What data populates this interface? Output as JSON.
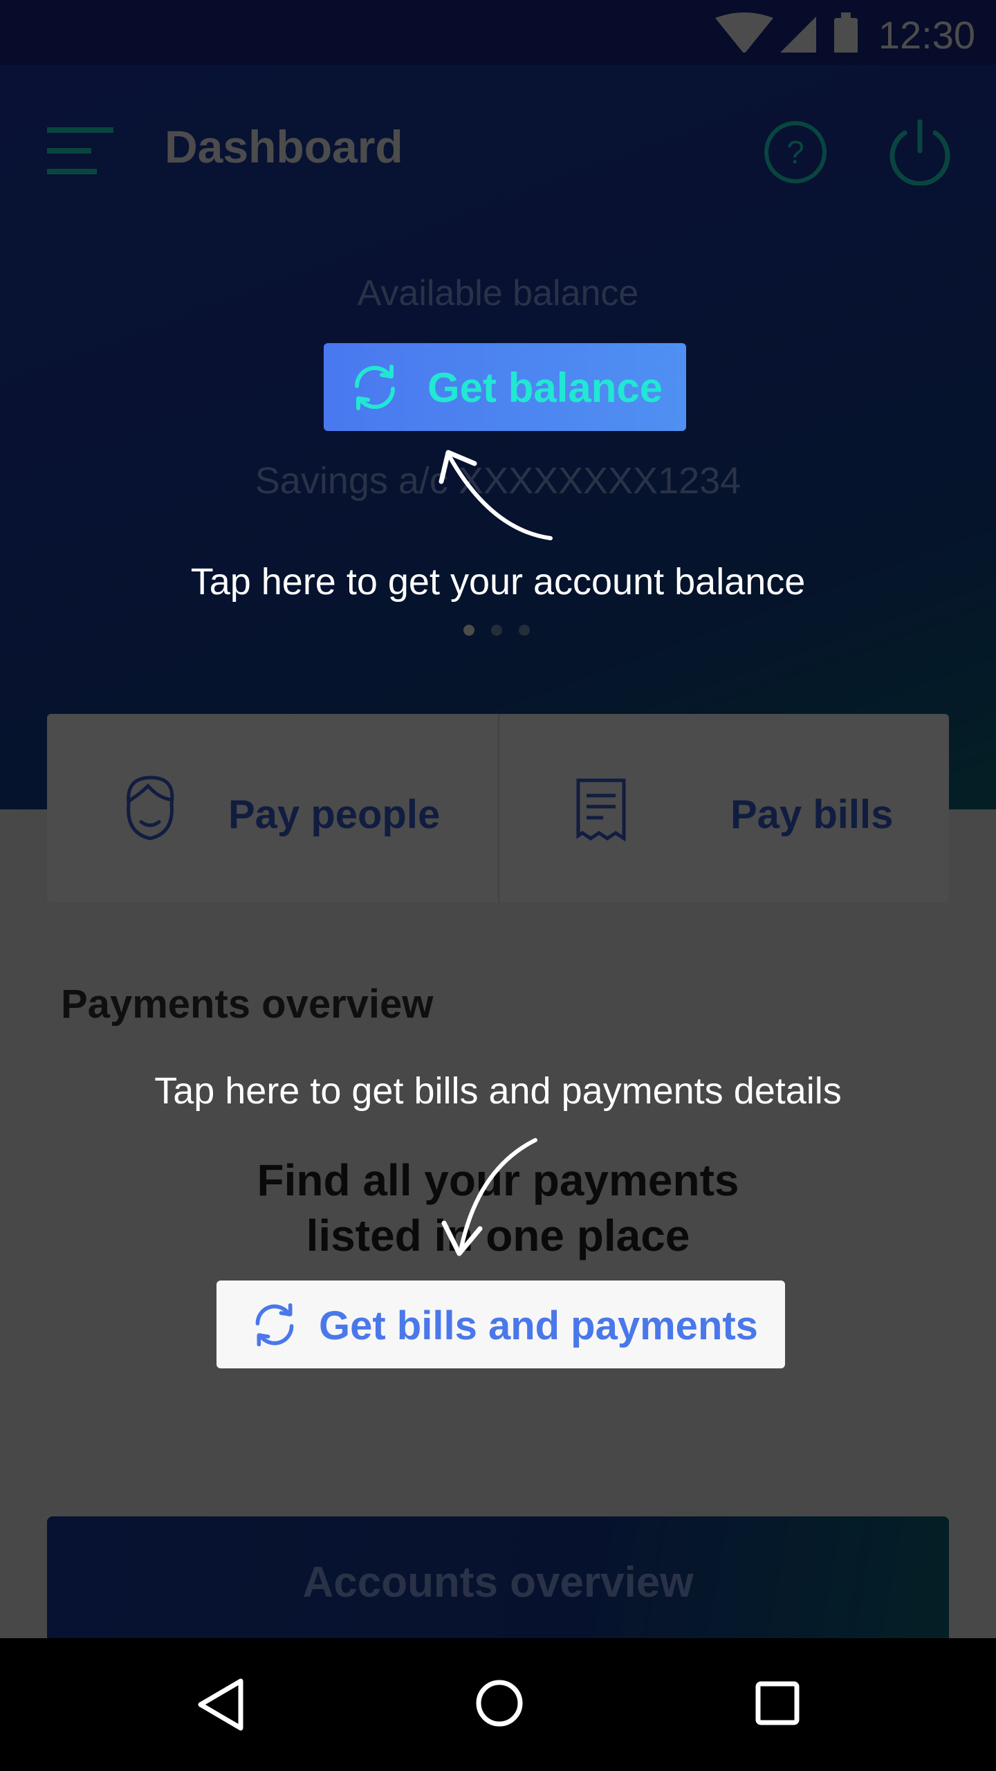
{
  "status_bar": {
    "time": "12:30",
    "icons": [
      "wifi-icon",
      "signal-icon",
      "battery-icon"
    ]
  },
  "app_bar": {
    "title": "Dashboard",
    "menu_icon": "menu-icon",
    "help_icon": "help-icon",
    "power_icon": "power-icon"
  },
  "balance": {
    "label": "Available balance",
    "button_label": "Get balance",
    "button_icon": "refresh-icon",
    "account": "Savings a/c XXXXXXXX1234",
    "pager_dots": 3,
    "pager_active": 0
  },
  "quick_actions": [
    {
      "label": "Pay people",
      "icon": "person-face-icon"
    },
    {
      "label": "Pay bills",
      "icon": "receipt-icon"
    }
  ],
  "payments": {
    "title": "Payments overview",
    "empty_line1": "Find all your payments",
    "empty_line2": "listed in one place",
    "button_label": "Get bills and payments",
    "button_icon": "refresh-icon"
  },
  "accounts": {
    "title": "Accounts overview"
  },
  "coachmarks": {
    "balance_hint": "Tap here to get your account balance",
    "payments_hint": "Tap here to get bills and payments details"
  },
  "nav_bar": {
    "icons": [
      "back-icon",
      "home-icon",
      "recents-icon"
    ]
  },
  "colors": {
    "brand_blue": "#1f3fb0",
    "accent_teal": "#21e7d3",
    "action_blue": "#4a78ef"
  }
}
